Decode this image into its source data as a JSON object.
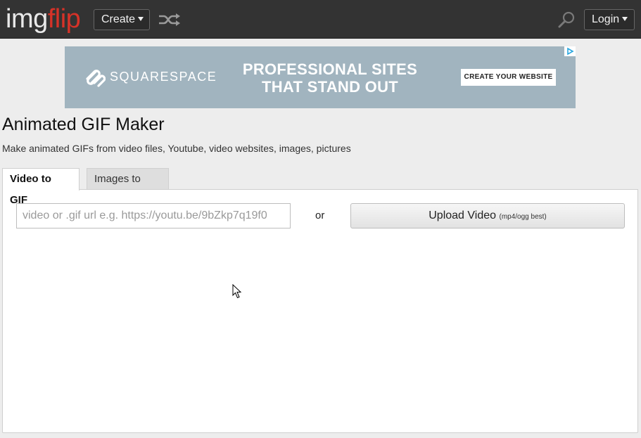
{
  "header": {
    "logo_img": "img",
    "logo_flip": "flip",
    "create_label": "Create",
    "login_label": "Login",
    "icons": [
      "shuffle-icon",
      "search-icon",
      "chevron-down-icon"
    ],
    "colors": {
      "bar": "#333333",
      "logo_accent": "#d63228"
    }
  },
  "ad": {
    "brand": "SQUARESPACE",
    "headline_line1": "PROFESSIONAL SITES",
    "headline_line2": "THAT STAND OUT",
    "cta": "CREATE YOUR WEBSITE",
    "background": "#a1b4bf"
  },
  "page": {
    "title": "Animated GIF Maker",
    "subtitle": "Make animated GIFs from video files, Youtube, video websites, images, pictures"
  },
  "tabs": [
    {
      "label": "Video to GIF",
      "active": true
    },
    {
      "label": "Images to GIF",
      "active": false
    }
  ],
  "video_panel": {
    "url_placeholder": "video or .gif url e.g. https://youtu.be/9bZkp7q19f0",
    "url_value": "",
    "or_label": "or",
    "upload_label": "Upload Video",
    "upload_hint": "(mp4/ogg best)"
  }
}
